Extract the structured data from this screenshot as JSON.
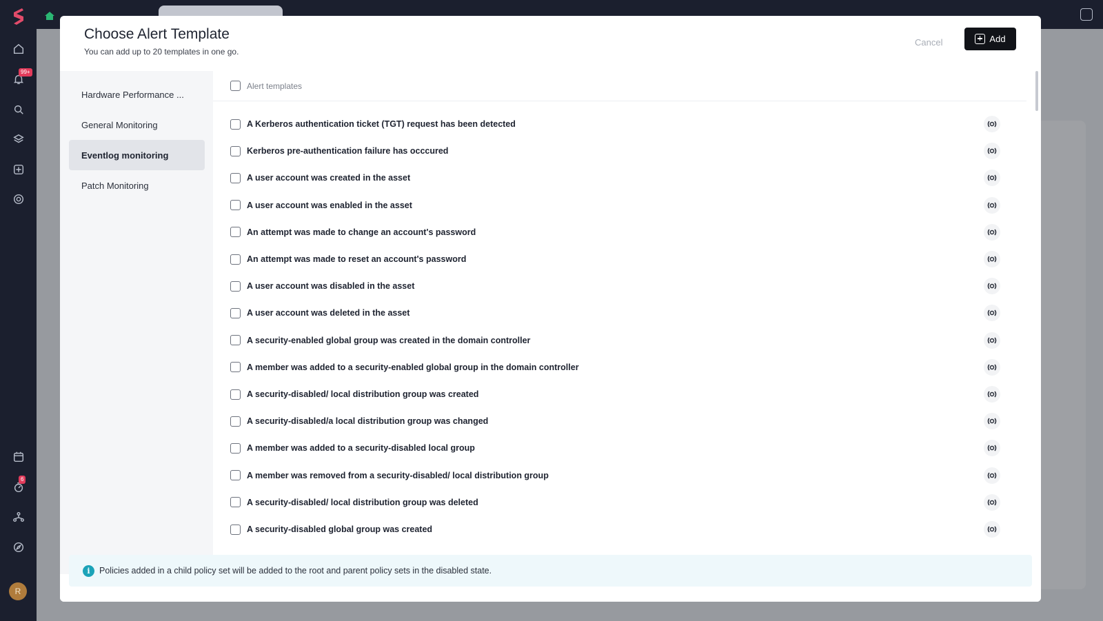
{
  "app": {
    "notifications_badge": "99+",
    "tasks_badge": "6",
    "avatar_initial": "R"
  },
  "modal": {
    "title": "Choose Alert Template",
    "subtitle": "You can add up to 20 templates in one go.",
    "cancel_label": "Cancel",
    "add_label": "Add"
  },
  "categories": [
    {
      "label": "Hardware Performance ...",
      "active": false
    },
    {
      "label": "General Monitoring",
      "active": false
    },
    {
      "label": "Eventlog monitoring",
      "active": true
    },
    {
      "label": "Patch Monitoring",
      "active": false
    }
  ],
  "list": {
    "header_label": "Alert templates",
    "items": [
      "A Kerberos authentication ticket (TGT) request has been detected",
      "Kerberos pre-authentication failure has occcured",
      "A user account was created in the asset",
      "A user account was enabled in the asset",
      "An attempt was made to change an account's password",
      "An attempt was made to reset an account's password",
      "A user account was disabled in the asset",
      "A user account was deleted in the asset",
      "A security-enabled global group was created in the domain controller",
      "A member was added to a security-enabled global group in the domain controller",
      "A security-disabled/ local distribution group was created",
      "A security-disabled/a local distribution group was changed",
      "A member was added to a security-disabled local group",
      "A member was removed from a security-disabled/ local distribution group",
      "A security-disabled/ local distribution group was deleted",
      "A security-disabled global group was created"
    ]
  },
  "info": {
    "text": "Policies added in a child policy set will be added to the root and parent policy sets in the disabled state."
  },
  "colors": {
    "sidebar_bg": "#1b1f2e",
    "primary_button": "#111318",
    "info_accent": "#1ba3b8",
    "badge": "#e23b5b"
  }
}
